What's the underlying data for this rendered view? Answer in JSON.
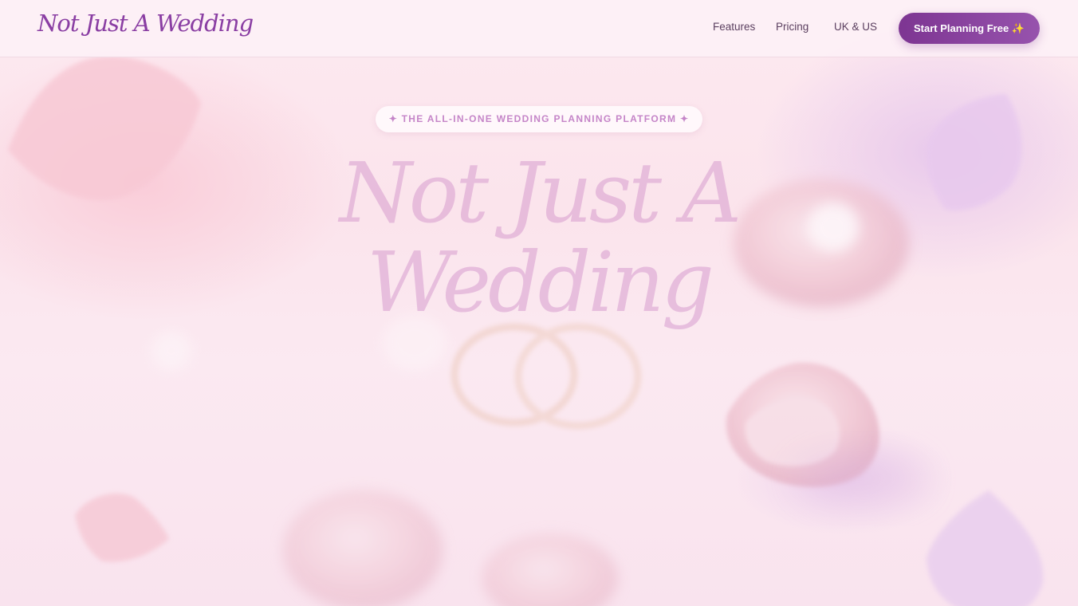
{
  "header": {
    "logo": "Not Just A Wedding",
    "nav": {
      "features": "Features",
      "pricing": "Pricing",
      "uk_us": "UK & US"
    },
    "cta_label": "Start Planning Free ✨"
  },
  "hero": {
    "tagline": "✦ THE ALL-IN-ONE WEDDING PLANNING PLATFORM ✦",
    "title_line1": "Not Just A",
    "title_line2": "Wedding",
    "subtitle": ""
  },
  "colors": {
    "brand_purple": "#7d3592",
    "logo_purple": "#8a3ea3",
    "tagline_pink": "#c585c8",
    "background_pink": "#fbe4ec"
  }
}
